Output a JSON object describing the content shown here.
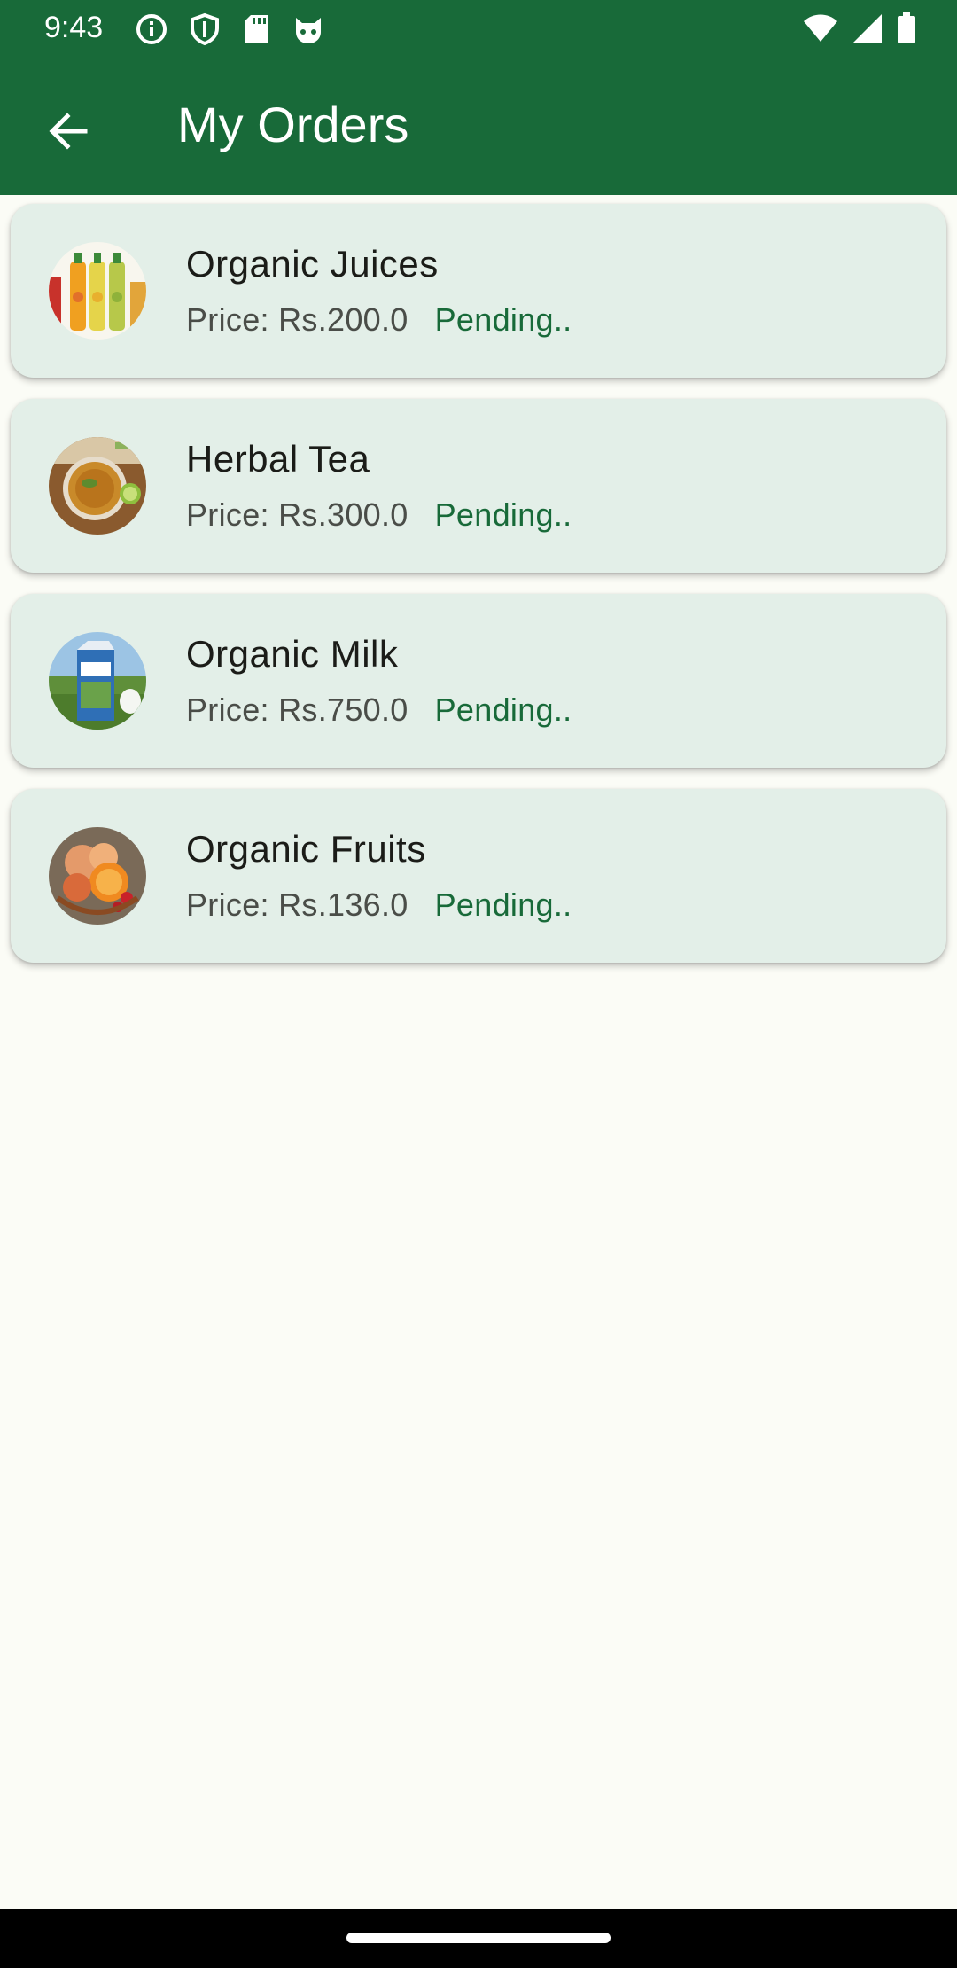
{
  "status_bar": {
    "time": "9:43",
    "left_icons": [
      "info-icon",
      "shield-icon",
      "sd-card-icon",
      "cat-face-icon"
    ],
    "right_icons": [
      "wifi-icon",
      "cellular-signal-icon",
      "battery-icon"
    ]
  },
  "app_bar": {
    "title": "My Orders",
    "back_icon": "arrow-back-icon",
    "color": "#186a39"
  },
  "orders": [
    {
      "name": "Organic Juices",
      "price": "Price: Rs.200.0",
      "status": "Pending..",
      "image": "juice-bottles-image"
    },
    {
      "name": "Herbal Tea",
      "price": "Price: Rs.300.0",
      "status": "Pending..",
      "image": "herbal-tea-image"
    },
    {
      "name": "Organic Milk",
      "price": "Price: Rs.750.0",
      "status": "Pending..",
      "image": "milk-carton-image"
    },
    {
      "name": "Organic Fruits",
      "price": "Price: Rs.136.0",
      "status": "Pending..",
      "image": "fruit-bowl-image"
    }
  ],
  "colors": {
    "primary": "#186a39",
    "card_background": "#e3efe8",
    "page_background": "#fbfcf6",
    "status_text": "#186a39"
  }
}
